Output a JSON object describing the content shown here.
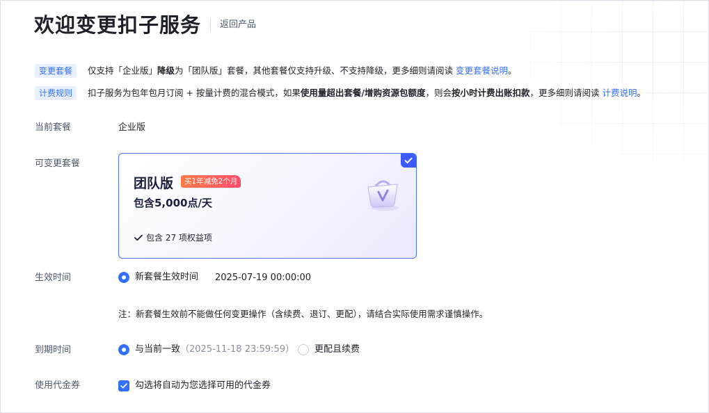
{
  "header": {
    "title": "欢迎变更扣子服务",
    "back_link": "返回产品"
  },
  "info": {
    "change_plan": {
      "tag": "变更套餐",
      "text_1": "仅支持「企业版」",
      "text_bold": "降级",
      "text_2": "为「团队版」套餐，其他套餐仅支持升级、不支持降级，更多细则请阅读 ",
      "link": "变更套餐说明",
      "text_end": "。"
    },
    "billing": {
      "tag": "计费规则",
      "text_1": "扣子服务为包年包月订阅 + 按量计费的混合模式，如果",
      "text_bold_1": "使用量超出套餐/增购资源包额度",
      "text_2": "，则会",
      "text_bold_2": "按小时计费出账扣款",
      "text_3": "，更多细则请阅读 ",
      "link": "计费说明",
      "text_end": "。"
    }
  },
  "form": {
    "current_plan": {
      "label": "当前套餐",
      "value": "企业版"
    },
    "available_plans": {
      "label": "可变更套餐",
      "card": {
        "name": "团队版",
        "promo": "买1年减免2个月",
        "points": "包含5,000点/天",
        "benefits": "包含 27 项权益项",
        "selected": true
      }
    },
    "effective_time": {
      "label": "生效时间",
      "option_label": "新套餐生效时间",
      "option_value": "2025-07-19 00:00:00",
      "note": "注：新套餐生效前不能做任何变更操作（含续费、退订、更配），请结合实际使用需求谨慎操作。"
    },
    "expiry_time": {
      "label": "到期时间",
      "option_1": "与当前一致",
      "option_1_detail": "（2025-11-18 23:59:59）",
      "option_2": "更配且续费",
      "selected": "option_1"
    },
    "voucher": {
      "label": "使用代金券",
      "checkbox_label": "勾选将自动为您选择可用的代金券",
      "checked": true
    }
  },
  "colors": {
    "accent": "#3370ff",
    "card_border": "#4e6ef2",
    "promo_start": "#ff7a45",
    "promo_end": "#ff4d6d",
    "tag_bg": "#e8f0ff"
  },
  "icons": {
    "card_check": "check-icon",
    "benefit": "checkmark-icon",
    "plan_illustration": "shopping-basket-icon",
    "voucher_checkbox": "check-icon"
  }
}
